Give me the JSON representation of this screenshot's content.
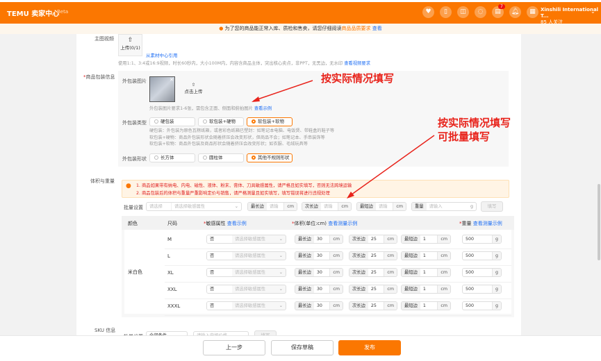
{
  "header": {
    "logo": "TEMU 卖家中心",
    "beta": "Beta",
    "badge_count": "7",
    "account_name": "Xinshili International T...",
    "account_followers": "85 人关注",
    "icons": [
      "shield-heart-icon",
      "phone-icon",
      "book-icon",
      "chat-icon",
      "document-icon",
      "bell-icon",
      "store-icon"
    ]
  },
  "notice": {
    "text": "为了您的商品能正常入库、质检和售卖，请您仔细阅读",
    "link1": "商品品质要求",
    "link2": "查看"
  },
  "video": {
    "label": "主图视频",
    "upload": "上传(0/1)",
    "material_link": "从素材中心引用",
    "hint": "使用1:1、3:4或16:9视频，时长60秒内，大小100M内，内容含商品主体，突出核心卖点，非PPT，无黑边，无水印",
    "hint_link": "查看视频要求"
  },
  "packaging": {
    "label": "商品包装信息",
    "image_label": "外包装图片",
    "upload": "点击上传",
    "image_hint": "外包装图片要求1-6张，需包含正面、侧面和俯拍图片",
    "image_hint_link": "查看示例",
    "type_label": "外包装类型",
    "types": [
      "硬包装",
      "软包装+硬物",
      "软包装+软物"
    ],
    "type_selected": 2,
    "type_desc": [
      "硬包装：外包装为原色瓦楞纸箱，或者彩色纸箱已塑封：如笔记本电脑、电饭煲、带鞋盒的鞋子等",
      "软包装+硬物：商品外包装形状会随着挤压会改变形状，但商品不会；如笔记本、手串装饰等",
      "软包装+软物：商品外包装及商品形状会随着挤压会改变形状；如衣服、毛绒玩具等"
    ],
    "shape_label": "外包装形状",
    "shapes": [
      "长方体",
      "圆柱体",
      "其他不规则形状"
    ],
    "shape_selected": 2
  },
  "annotations": {
    "a1": "按实际情况填写",
    "a2": "按实际情况填写",
    "a3": "可批量填写"
  },
  "volume": {
    "label": "体积与重量",
    "warn1": "1. 商品如果带有纳电、内电、磁性、液体、粉末、膏体、刀具敏感属性，请严格且如实填写，否则无法跨境运输",
    "warn2": "2. 商品包装后的体积与重量严重影响定价与销售，请严格测量且如实填写，填写错误将进行违规处理",
    "bulk": {
      "label": "批量设置",
      "select": "请选择",
      "attr": "请选择敏感属性",
      "longest": "最长边",
      "middle": "次长边",
      "shortest": "最短边",
      "weight": "重量",
      "placeholder": "请输入",
      "cm": "cm",
      "g": "g",
      "fill": "填写"
    },
    "columns": {
      "color": "颜色",
      "size": "尺码",
      "sensitive": "敏感属性",
      "sensitive_link": "查看示例",
      "volume": "体积(单位:cm)",
      "volume_link": "查看测量示例",
      "weight": "重量",
      "weight_link": "查看测量示例"
    },
    "color_value": "米白色",
    "rows": [
      {
        "size": "M",
        "sensitive": "否",
        "attr": "请选择敏感属性",
        "longest": "30",
        "middle": "25",
        "shortest": "1",
        "weight": "500"
      },
      {
        "size": "L",
        "sensitive": "否",
        "attr": "请选择敏感属性",
        "longest": "30",
        "middle": "25",
        "shortest": "1",
        "weight": "500"
      },
      {
        "size": "XL",
        "sensitive": "否",
        "attr": "请选择敏感属性",
        "longest": "30",
        "middle": "25",
        "shortest": "1",
        "weight": "500"
      },
      {
        "size": "XXL",
        "sensitive": "否",
        "attr": "请选择敏感属性",
        "longest": "30",
        "middle": "25",
        "shortest": "1",
        "weight": "500"
      },
      {
        "size": "XXXL",
        "sensitive": "否",
        "attr": "请选择敏感属性",
        "longest": "30",
        "middle": "25",
        "shortest": "1",
        "weight": "500"
      }
    ]
  },
  "sku": {
    "label": "SKU 信息",
    "bulk_label": "批量设置",
    "select": "全部条件",
    "placeholder": "请输入申报价格",
    "fill": "填写"
  },
  "footer": {
    "prev": "上一步",
    "save": "保存草稿",
    "publish": "发布"
  }
}
